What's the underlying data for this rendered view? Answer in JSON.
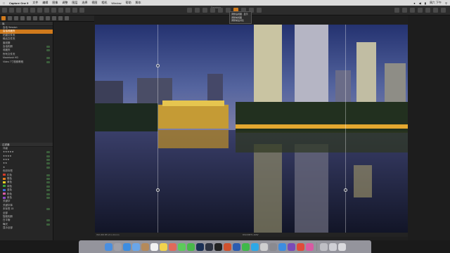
{
  "menubar": {
    "app_name": "Capture One 9",
    "items": [
      "文件",
      "编辑",
      "图像",
      "调整",
      "图层",
      "选择",
      "视图",
      "相机",
      "Window",
      "帮助",
      "脚本"
    ],
    "clock": "周六 下午"
  },
  "window": {
    "title": "Sessions"
  },
  "view_dropdown": {
    "options": [
      "调整后视图 · 显示",
      "调整前视图",
      "调整前后对比"
    ]
  },
  "sidebar": {
    "top_panel_title": "库",
    "items": [
      {
        "label": "会话 Session",
        "selected": false
      },
      {
        "label": "会话收藏夹",
        "selected": true
      },
      {
        "label": "拍摄文件夹",
        "selected": false
      },
      {
        "label": "输出文件夹",
        "selected": false
      },
      {
        "label": "废纸篓",
        "selected": false
      },
      {
        "label": "会话相册",
        "selected": false
      },
      {
        "label": "收藏夹",
        "selected": false
      },
      {
        "label": "所有文件夹",
        "selected": false
      },
      {
        "label": "Macintosh HD",
        "selected": false
      },
      {
        "label": "Video 7寸视频教程",
        "selected": false
      }
    ],
    "filter_panel_title": "过滤器",
    "filter_rows": [
      "评级",
      "★★★★★",
      "★★★★",
      "★★★",
      "★★",
      "★",
      "色彩标签",
      "红色",
      "橙色",
      "黄色",
      "绿色",
      "蓝色",
      "粉色",
      "紫色",
      "关键字",
      "关键字库",
      "未标签 15",
      "全部",
      "智能相册",
      "白平衡",
      "曝光",
      "显示全部"
    ],
    "label_colors": [
      "#d23a2a",
      "#e07b1f",
      "#e3cc25",
      "#3aa33a",
      "#3a6ad8",
      "#d85aa3",
      "#8a4ac8"
    ]
  },
  "status_bar": {
    "left": "ISO 200   f/8   1/4 s   24 mm",
    "center": "DSC09871.ARW"
  },
  "colors": {
    "accent": "#d07a1c",
    "sky_top": "#2b3a78",
    "sky_bottom": "#6e7fb8",
    "water": "#14182c"
  }
}
